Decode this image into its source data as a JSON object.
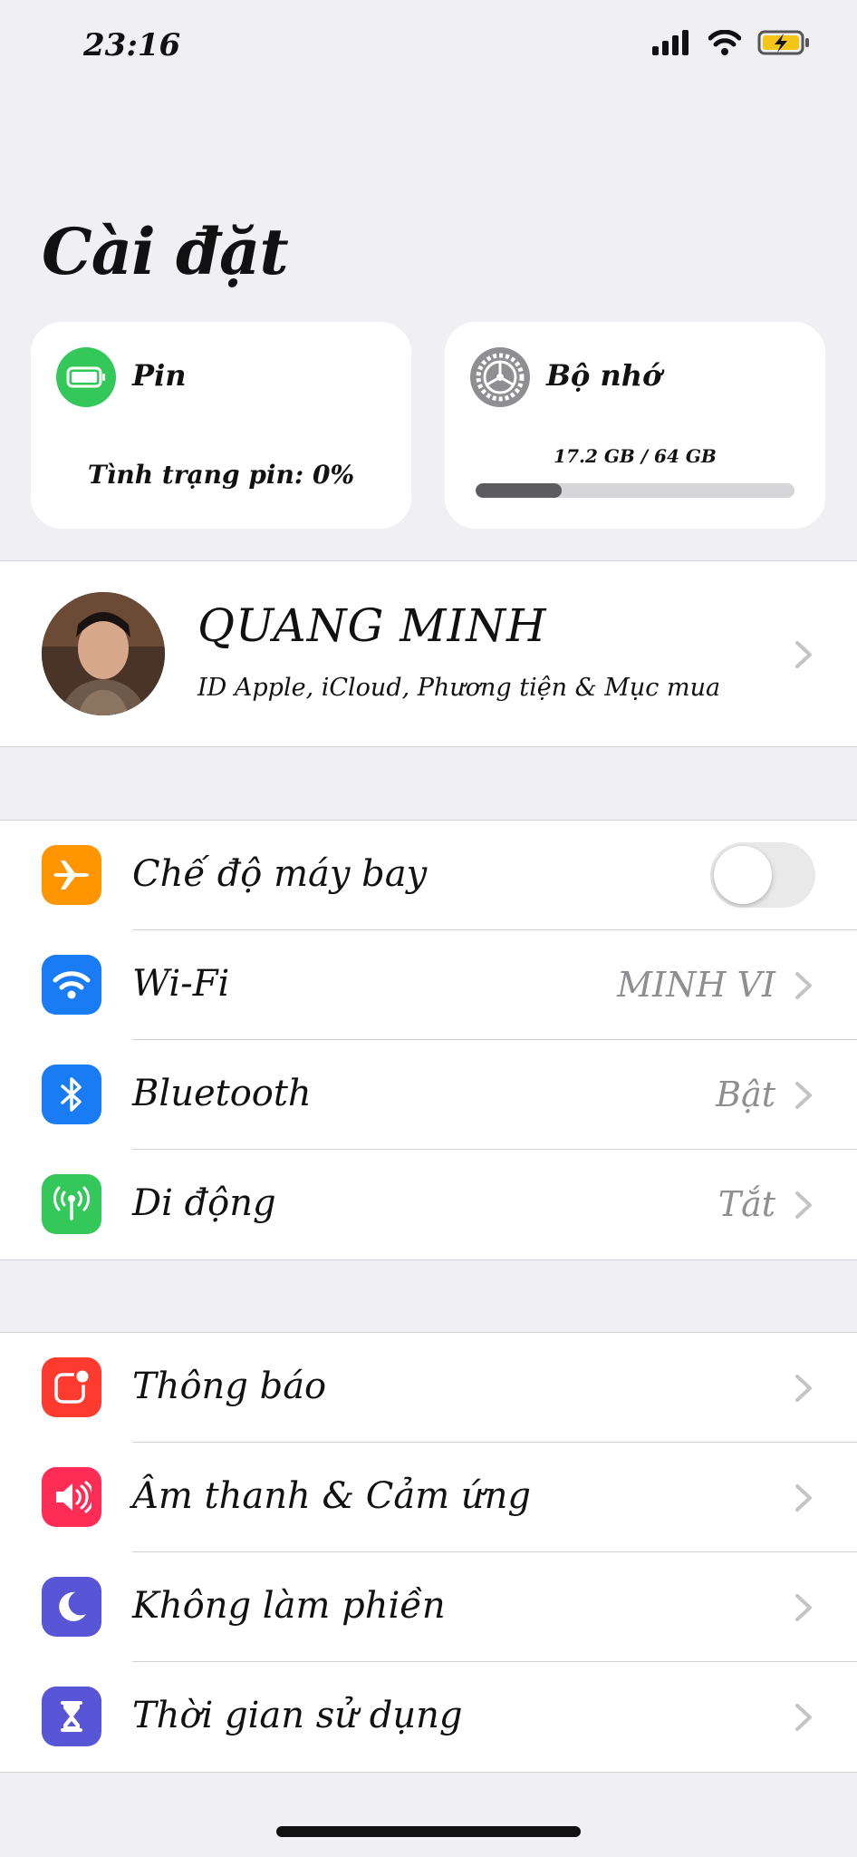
{
  "status_bar": {
    "time": "23:16"
  },
  "title": "Cài đặt",
  "cards": {
    "battery": {
      "title": "Pin",
      "status": "Tình trạng pin: 0%",
      "icon": "battery-icon",
      "color": "#34c759"
    },
    "storage": {
      "title": "Bộ nhớ",
      "used_text": "17.2 GB / 64 GB",
      "used_fraction": 0.27,
      "icon": "gear-icon",
      "color": "#8e8e93"
    }
  },
  "profile": {
    "name": "QUANG MINH",
    "subtitle": "ID Apple, iCloud, Phương tiện & Mục mua"
  },
  "group1": [
    {
      "label": "Chế độ máy bay",
      "value": "",
      "icon": "airplane-icon",
      "color": "#ff9500",
      "toggle": false
    },
    {
      "label": "Wi-Fi",
      "value": "MINH VI",
      "icon": "wifi-icon",
      "color": "#1a7cf5"
    },
    {
      "label": "Bluetooth",
      "value": "Bật",
      "icon": "bluetooth-icon",
      "color": "#1a7cf5"
    },
    {
      "label": "Di động",
      "value": "Tắt",
      "icon": "antenna-icon",
      "color": "#34c759"
    }
  ],
  "group2": [
    {
      "label": "Thông báo",
      "icon": "notification-icon",
      "color": "#ff3b30"
    },
    {
      "label": "Âm thanh & Cảm ứng",
      "icon": "speaker-icon",
      "color": "#ff2d55"
    },
    {
      "label": "Không làm phiền",
      "icon": "moon-icon",
      "color": "#5856d6"
    },
    {
      "label": "Thời gian sử dụng",
      "icon": "hourglass-icon",
      "color": "#5856d6"
    }
  ]
}
